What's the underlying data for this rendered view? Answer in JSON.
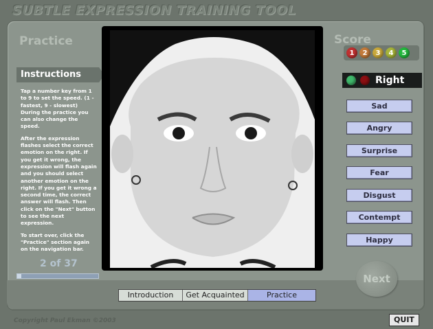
{
  "app_title": "SUBTLE EXPRESSION TRAINING TOOL",
  "section_title": "Practice",
  "score_title": "Score",
  "instructions": {
    "heading": "Instructions",
    "paragraphs": [
      "Tap a number key from 1 to 9 to set the speed. (1 - fastest, 9 - slowest) During the practice you can also change the speed.",
      "After the expression flashes select the correct emotion on the right. If you get it wrong, the expression will flash again and you should select another emotion on the right. If you get it wrong a second time, the correct answer will flash. Then click on the \"Next\" button to see the next expression.",
      "To start over, click the \"Practice\" section again on the navigation bar."
    ]
  },
  "progress": {
    "text": "2 of 37",
    "current": 2,
    "total": 37
  },
  "score_dots": [
    {
      "label": "1",
      "color": "#c03131"
    },
    {
      "label": "2",
      "color": "#c27a3a"
    },
    {
      "label": "3",
      "color": "#c8a83b"
    },
    {
      "label": "4",
      "color": "#a6b43a"
    },
    {
      "label": "5",
      "color": "#23b83d"
    }
  ],
  "result": {
    "text": "Right",
    "indicator_colors": [
      "#40b86b",
      "#8b0f12"
    ]
  },
  "emotions": [
    "Sad",
    "Angry",
    "Surprise",
    "Fear",
    "Disgust",
    "Contempt",
    "Happy"
  ],
  "next_label": "Next",
  "nav": [
    {
      "label": "Introduction",
      "active": false
    },
    {
      "label": "Get Acquainted",
      "active": false
    },
    {
      "label": "Practice",
      "active": true
    }
  ],
  "copyright": "Copyright Paul Ekman ©2003",
  "quit_label": "QUIT"
}
